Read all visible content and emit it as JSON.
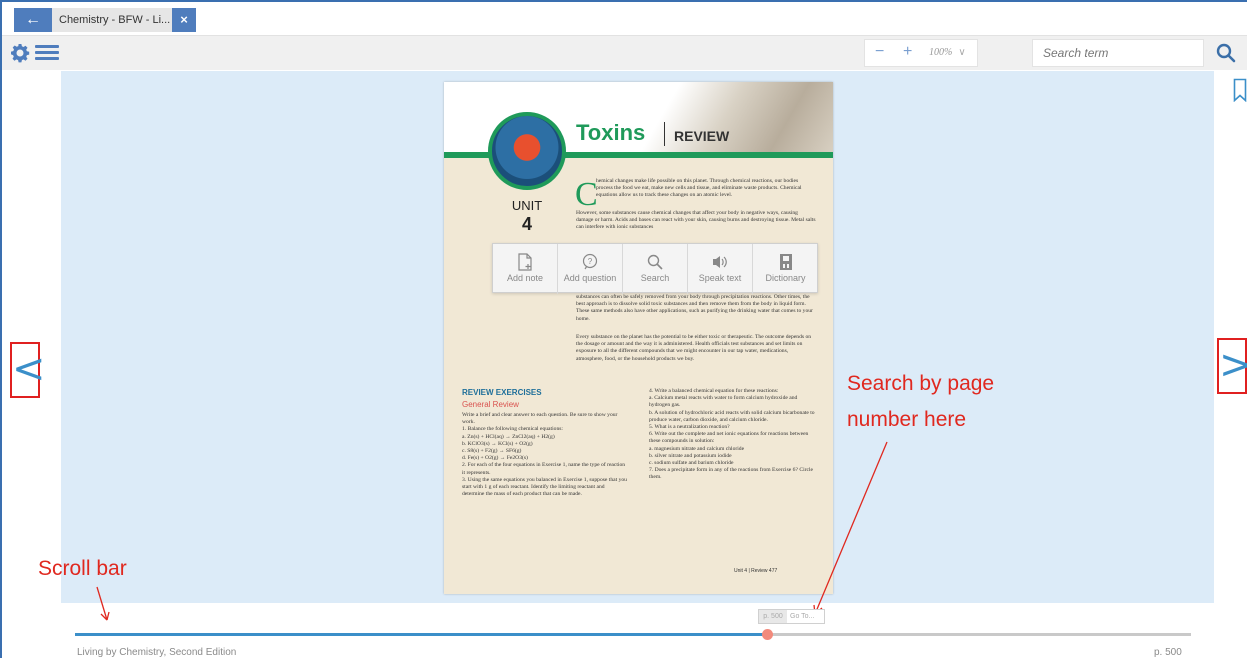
{
  "tab": {
    "back_label": "←",
    "title": "Chemistry - BFW - Li...",
    "close_label": "×"
  },
  "toolbar": {
    "zoom_out": "−",
    "zoom_in": "+",
    "zoom_value": "100%",
    "zoom_chevron": "∨",
    "search_placeholder": "Search term"
  },
  "page": {
    "title": "Toxins",
    "section": "REVIEW",
    "unit_label": "UNIT",
    "unit_number": "4",
    "dropcap": "C",
    "intro_text": "hemical changes make life possible on this planet. Through chemical reactions, our bodies process the food we eat, make new cells and tissue, and eliminate waste products. Chemical equations allow us to track these changes on an atomic level.",
    "para2": "However, some substances cause chemical changes that affect your body in negative ways, causing damage or harm. Acids and bases can react with your skin, causing burns and destroying tissue. Metal salts can interfere with ionic substances",
    "para3": "substances can often be safely removed from your body through precipitation reactions. Other times, the best approach is to dissolve solid toxic substances and then remove them from the body in liquid form. These same methods also have other applications, such as purifying the drinking water that comes to your home.",
    "para4": "Every substance on the planet has the potential to be either toxic or therapeutic. The outcome depends on the dosage or amount and the way it is administered. Health officials test substances and set limits on exposure to all the different compounds that we might encounter in our tap water, medications, atmosphere, food, or the household products we buy.",
    "review_exercises": "REVIEW EXERCISES",
    "general_review": "General Review",
    "left_col": "Write a brief and clear answer to each question. Be sure to show your work.\n1. Balance the following chemical equations:\na. Zn(s) + HCl(aq) → ZnCl2(aq) + H2(g)\nb. KClO3(s) → KCl(s) + O2(g)\nc. S8(s) + F2(g) → SF6(g)\nd. Fe(s) + O2(g) → Fe2O3(s)\n2. For each of the four equations in Exercise 1, name the type of reaction it represents.\n3. Using the same equations you balanced in Exercise 1, suppose that you start with 1 g of each reactant. Identify the limiting reactant and determine the mass of each product that can be made.",
    "right_col": "4. Write a balanced chemical equation for these reactions:\na. Calcium metal reacts with water to form calcium hydroxide and hydrogen gas.\nb. A solution of hydrochloric acid reacts with solid calcium bicarbonate to produce water, carbon dioxide, and calcium chloride.\n5. What is a neutralization reaction?\n6. Write out the complete and net ionic equations for reactions between these compounds in solution:\na. magnesium nitrate and calcium chloride\nb. silver nitrate and potassium iodide\nc. sodium sulfate and barium chloride\n7. Does a precipitate form in any of the reactions from Exercise 6? Circle them.",
    "footer": "Unit 4 | Review 477"
  },
  "popup": {
    "items": [
      {
        "label": "Add note"
      },
      {
        "label": "Add question"
      },
      {
        "label": "Search"
      },
      {
        "label": "Speak text"
      },
      {
        "label": "Dictionary"
      }
    ]
  },
  "nav": {
    "prev": "<",
    "next": ">"
  },
  "annotations": {
    "scroll_bar": "Scroll bar",
    "search_page_line1": "Search by page",
    "search_page_line2": "number here"
  },
  "bottom": {
    "scroll_progress": 0.62,
    "page_current": "p. 500",
    "page_input_placeholder": "Go To...",
    "book_name": "Living by Chemistry, Second Edition",
    "page_label": "p. 500"
  },
  "colors": {
    "accent": "#3b8fc9",
    "tab_blue": "#4f7dbd",
    "annotation_red": "#e0281f",
    "viewer_bg": "#dcebf8",
    "green": "#1f9a5a"
  }
}
